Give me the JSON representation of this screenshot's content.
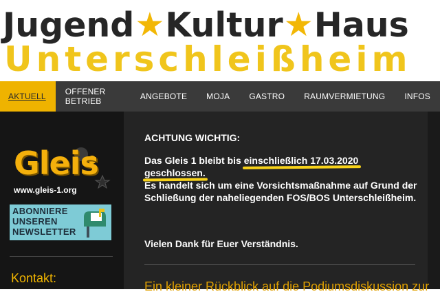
{
  "header": {
    "logo_words": [
      "Jugend",
      "Kultur",
      "Haus"
    ],
    "logo_line2": "Unterschleißheim",
    "star_glyph": "★",
    "star_color": "#f2b705",
    "brand_yellow": "#f0c51c"
  },
  "nav": {
    "items": [
      {
        "label": "AKTUELL",
        "active": true
      },
      {
        "label": "OFFENER BETRIEB"
      },
      {
        "label": "ANGEBOTE"
      },
      {
        "label": "MOJA"
      },
      {
        "label": "GASTRO"
      },
      {
        "label": "RAUMVERMIETUNG"
      },
      {
        "label": "INFOS"
      }
    ],
    "active_color": "#efb300"
  },
  "sidebar": {
    "gleis_logo_text": "Gleis",
    "gleis_url": "www.gleis-1.org",
    "newsletter": {
      "lines": [
        "ABONNIERE",
        "UNSEREN",
        "NEWSLETTER"
      ],
      "icon": "mailbox-icon"
    },
    "kontakt_label": "Kontakt:"
  },
  "main": {
    "heading": "ACHTUNG WICHTIG:",
    "body_part1": "Das Gleis 1 bleibt bis ",
    "body_highlight1": "einschließlich 17.03.2020",
    "body_highlight2": "geschlossen.",
    "body_part2": "Es handelt sich um eine Vorsichtsmaßnahme auf Grund der Schließung der naheliegenden FOS/BOS Unterschleißheim.",
    "thanks": "Vielen Dank für Euer Verständnis.",
    "post_title": "Ein kleiner Rückblick auf die Podiumsdiskussion zur"
  }
}
